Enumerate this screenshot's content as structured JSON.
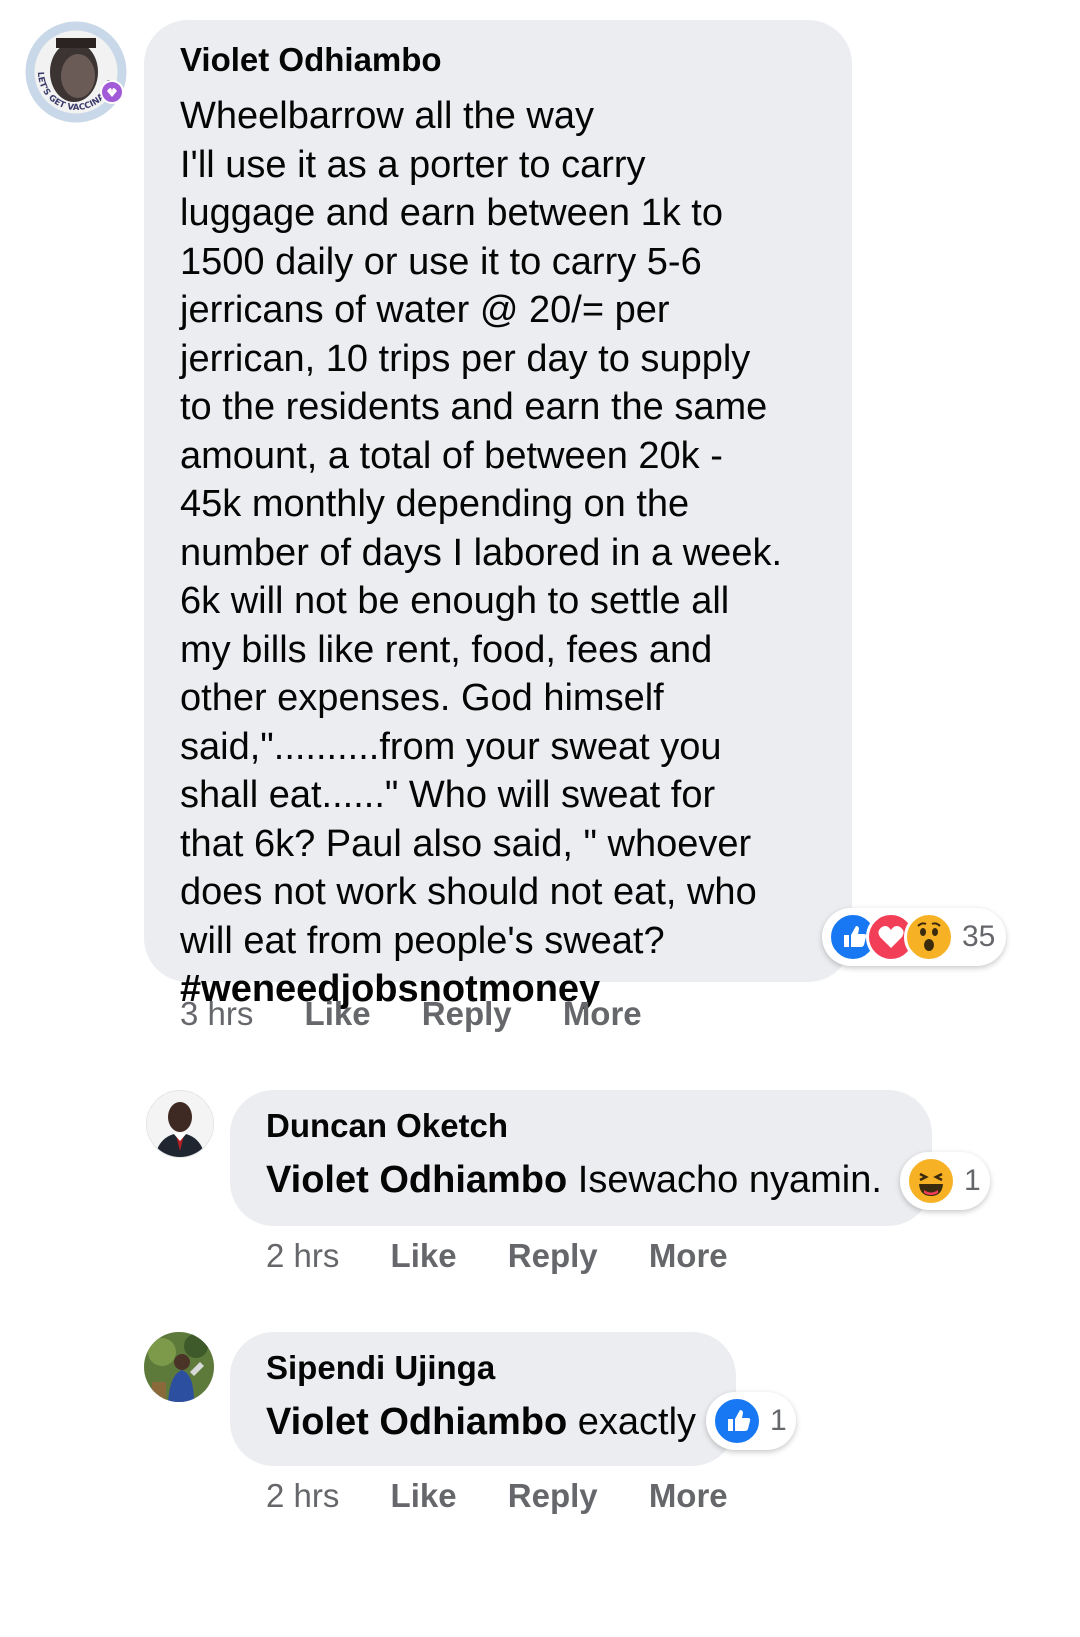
{
  "comments": [
    {
      "author": "Violet Odhiambo",
      "text": "Wheelbarrow all the way\nI'll use it as a porter to carry\nluggage and earn between 1k to\n1500 daily or use it to carry 5-6\njerricans of water @ 20/= per\njerrican, 10 trips per day to supply\nto the residents and earn the same\namount, a total of between 20k -\n45k monthly depending on the\nnumber of days I labored in a week.\n6k will not be enough to settle all\nmy bills like rent, food, fees and\nother expenses. God himself\nsaid,\"..........from your sweat you\nshall eat......\" Who will sweat for\nthat 6k? Paul also said, \" whoever\ndoes not work should not eat, who\nwill eat from people's sweat?",
      "hashtag": "#weneedjobsnotmoney",
      "avatar_badge": "LET'S GET VACCINATED",
      "reactions": [
        "like",
        "love",
        "wow"
      ],
      "reaction_count": "35",
      "time": "3 hrs",
      "like_label": "Like",
      "reply_label": "Reply",
      "more_label": "More"
    },
    {
      "author": "Duncan Oketch",
      "mention": "Violet Odhiambo",
      "text": "Isewacho nyamin.",
      "reactions": [
        "haha"
      ],
      "reaction_count": "1",
      "time": "2 hrs",
      "like_label": "Like",
      "reply_label": "Reply",
      "more_label": "More"
    },
    {
      "author": "Sipendi Ujinga",
      "mention": "Violet Odhiambo",
      "text": "exactly",
      "reactions": [
        "like"
      ],
      "reaction_count": "1",
      "time": "2 hrs",
      "like_label": "Like",
      "reply_label": "Reply",
      "more_label": "More"
    }
  ],
  "colors": {
    "bubble": "#ebedf0",
    "like_blue": "#1877f2",
    "love_red": "#f33e58",
    "wow_yellow": "#f7b125",
    "meta_gray": "#65676b"
  }
}
